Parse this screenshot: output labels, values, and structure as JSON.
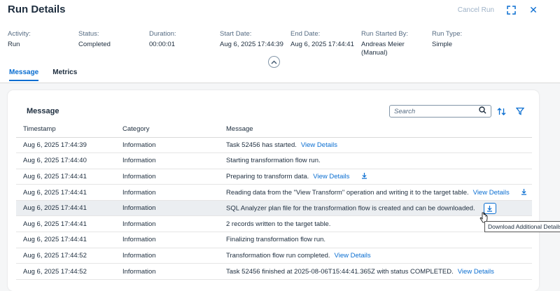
{
  "header": {
    "title": "Run Details",
    "cancel_run": "Cancel Run",
    "close_glyph": "✕",
    "fullscreen_glyph": "⛶"
  },
  "attributes": [
    {
      "label": "Activity:",
      "value": "Run"
    },
    {
      "label": "Status:",
      "value": "Completed"
    },
    {
      "label": "Duration:",
      "value": "00:00:01"
    },
    {
      "label": "Start Date:",
      "value": "Aug 6, 2025 17:44:39"
    },
    {
      "label": "End Date:",
      "value": "Aug 6, 2025 17:44:41"
    },
    {
      "label": "Run Started By:",
      "value": "Andreas Meier (Manual)"
    },
    {
      "label": "Run Type:",
      "value": "Simple"
    }
  ],
  "tabs": [
    {
      "label": "Message",
      "active": true
    },
    {
      "label": "Metrics",
      "active": false
    }
  ],
  "card": {
    "title": "Message",
    "search_placeholder": "Search",
    "columns": [
      "Timestamp",
      "Category",
      "Message"
    ]
  },
  "rows": [
    {
      "timestamp": "Aug 6, 2025 17:44:39",
      "category": "Information",
      "message": "Task 52456 has started.",
      "link": "View Details",
      "download": false
    },
    {
      "timestamp": "Aug 6, 2025 17:44:40",
      "category": "Information",
      "message": "Starting transformation flow run.",
      "link": "",
      "download": false
    },
    {
      "timestamp": "Aug 6, 2025 17:44:41",
      "category": "Information",
      "message": "Preparing to transform data.",
      "link": "View Details",
      "download": true
    },
    {
      "timestamp": "Aug 6, 2025 17:44:41",
      "category": "Information",
      "message": "Reading data from the \"View Transform\" operation and writing it to the target table.",
      "link": "View Details",
      "download": true
    },
    {
      "timestamp": "Aug 6, 2025 17:44:41",
      "category": "Information",
      "message": "SQL Analyzer plan file for the transformation flow is created and can be downloaded.",
      "link": "",
      "download": true,
      "highlight": true
    },
    {
      "timestamp": "Aug 6, 2025 17:44:41",
      "category": "Information",
      "message": "2 records written to the target table.",
      "link": "",
      "download": false
    },
    {
      "timestamp": "Aug 6, 2025 17:44:41",
      "category": "Information",
      "message": "Finalizing transformation flow run.",
      "link": "",
      "download": false
    },
    {
      "timestamp": "Aug 6, 2025 17:44:52",
      "category": "Information",
      "message": "Transformation flow run completed.",
      "link": "View Details",
      "download": false
    },
    {
      "timestamp": "Aug 6, 2025 17:44:52",
      "category": "Information",
      "message": "Task 52456 finished at 2025-08-06T15:44:41.365Z with status COMPLETED.",
      "link": "View Details",
      "download": false
    }
  ],
  "tooltip": "Download Additional Details",
  "colors": {
    "accent": "#0a6ed1",
    "text": "#1d2d3e",
    "muted": "#556b82"
  }
}
